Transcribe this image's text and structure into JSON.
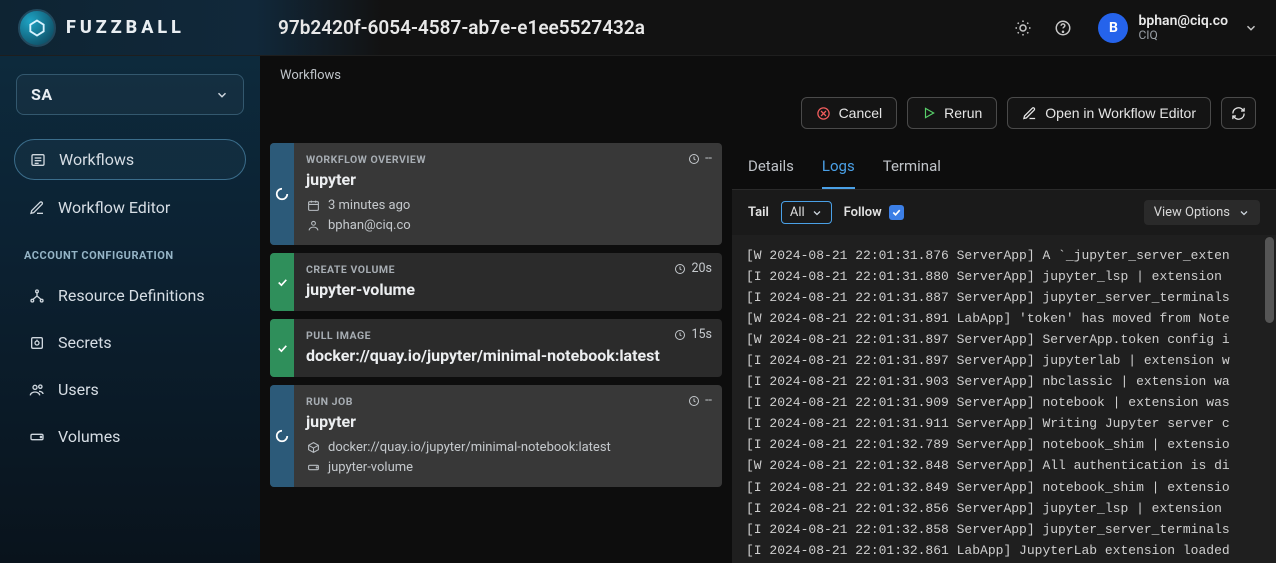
{
  "brand": {
    "name": "FUZZBALL",
    "initial": "B"
  },
  "header": {
    "workflow_id": "97b2420f-6054-4587-ab7e-e1ee5527432a",
    "user_email": "bphan@ciq.co",
    "user_org": "CIQ",
    "avatar_initial": "B"
  },
  "sidebar": {
    "account_selector": "SA",
    "items": [
      {
        "label": "Workflows"
      },
      {
        "label": "Workflow Editor"
      }
    ],
    "section_label": "ACCOUNT CONFIGURATION",
    "config_items": [
      {
        "label": "Resource Definitions"
      },
      {
        "label": "Secrets"
      },
      {
        "label": "Users"
      },
      {
        "label": "Volumes"
      }
    ]
  },
  "breadcrumb": "Workflows",
  "actions": {
    "cancel": "Cancel",
    "rerun": "Rerun",
    "open_editor": "Open in Workflow Editor"
  },
  "steps": [
    {
      "type": "WORKFLOW OVERVIEW",
      "title": "jupyter",
      "duration": "--",
      "status": "running",
      "meta": [
        {
          "icon": "calendar",
          "text": "3 minutes ago"
        },
        {
          "icon": "user",
          "text": "bphan@ciq.co"
        }
      ]
    },
    {
      "type": "CREATE VOLUME",
      "title": "jupyter-volume",
      "duration": "20s",
      "status": "done",
      "meta": []
    },
    {
      "type": "PULL IMAGE",
      "title": "docker://quay.io/jupyter/minimal-notebook:latest",
      "duration": "15s",
      "status": "done",
      "meta": []
    },
    {
      "type": "RUN JOB",
      "title": "jupyter",
      "duration": "--",
      "status": "running",
      "meta": [
        {
          "icon": "cube",
          "text": "docker://quay.io/jupyter/minimal-notebook:latest"
        },
        {
          "icon": "disk",
          "text": "jupyter-volume"
        }
      ]
    }
  ],
  "panel": {
    "tabs": {
      "details": "Details",
      "logs": "Logs",
      "terminal": "Terminal"
    },
    "toolbar": {
      "tail_label": "Tail",
      "tail_value": "All",
      "follow_label": "Follow",
      "follow_checked": true,
      "view_options": "View Options"
    },
    "log_lines": [
      "[W 2024-08-21 22:01:31.876 ServerApp] A `_jupyter_server_exten",
      "[I 2024-08-21 22:01:31.880 ServerApp] jupyter_lsp | extension ",
      "[I 2024-08-21 22:01:31.887 ServerApp] jupyter_server_terminals",
      "[W 2024-08-21 22:01:31.891 LabApp] 'token' has moved from Note",
      "[W 2024-08-21 22:01:31.897 ServerApp] ServerApp.token config i",
      "[I 2024-08-21 22:01:31.897 ServerApp] jupyterlab | extension w",
      "[I 2024-08-21 22:01:31.903 ServerApp] nbclassic | extension wa",
      "[I 2024-08-21 22:01:31.909 ServerApp] notebook | extension was",
      "[I 2024-08-21 22:01:31.911 ServerApp] Writing Jupyter server c",
      "[I 2024-08-21 22:01:32.789 ServerApp] notebook_shim | extensio",
      "[W 2024-08-21 22:01:32.848 ServerApp] All authentication is di",
      "[I 2024-08-21 22:01:32.849 ServerApp] notebook_shim | extensio",
      "[I 2024-08-21 22:01:32.856 ServerApp] jupyter_lsp | extension ",
      "[I 2024-08-21 22:01:32.858 ServerApp] jupyter_server_terminals",
      "[I 2024-08-21 22:01:32.861 LabApp] JupyterLab extension loaded"
    ]
  }
}
